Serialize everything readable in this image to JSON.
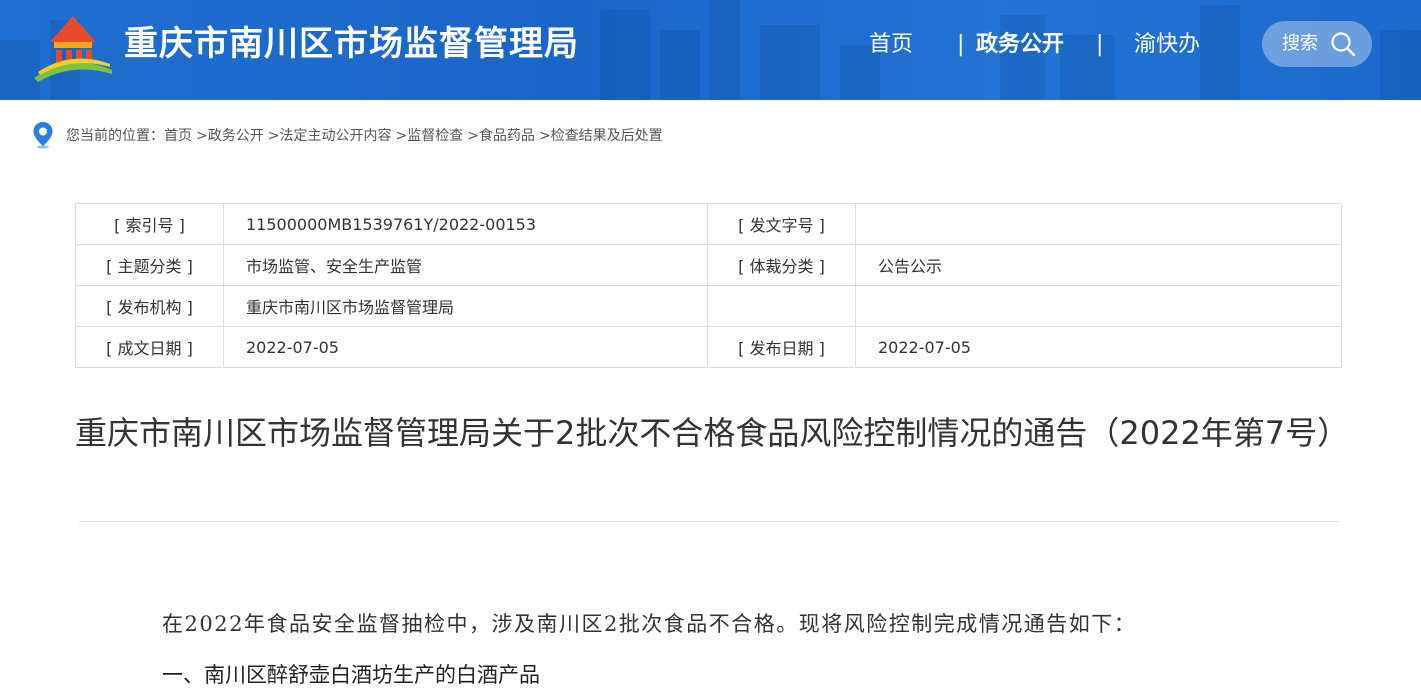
{
  "header": {
    "site_title": "重庆市南川区市场监督管理局",
    "nav": {
      "home": "首页",
      "sep": "|",
      "gov_open": "政务公开",
      "yu_kuai_ban": "渝快办"
    },
    "search_label": "搜索",
    "colors": {
      "header_bg": "#1f6fd0"
    }
  },
  "breadcrumb": {
    "prefix": "您当前的位置：",
    "items": [
      "首页",
      ">政务公开",
      ">法定主动公开内容",
      ">监督检查",
      ">食品药品",
      ">检查结果及后处置"
    ]
  },
  "info_table": {
    "rows": [
      {
        "label1": "[ 索引号 ]",
        "value1": "11500000MB1539761Y/2022-00153",
        "label2": "[ 发文字号 ]",
        "value2": ""
      },
      {
        "label1": "[ 主题分类 ]",
        "value1": "市场监管、安全生产监管",
        "label2": "[ 体裁分类 ]",
        "value2": "公告公示"
      },
      {
        "label1": "[ 发布机构 ]",
        "value1": "重庆市南川区市场监督管理局",
        "label2": "",
        "value2": ""
      },
      {
        "label1": "[ 成文日期 ]",
        "value1": "2022-07-05",
        "label2": "[ 发布日期 ]",
        "value2": "2022-07-05"
      }
    ]
  },
  "document": {
    "title": "重庆市南川区市场监督管理局关于2批次不合格食品风险控制情况的通告（2022年第7号）",
    "intro": "在2022年食品安全监督抽检中，涉及南川区2批次食品不合格。现将风险控制完成情况通告如下：",
    "section1": "一、南川区醉舒壶白酒坊生产的白酒产品"
  }
}
